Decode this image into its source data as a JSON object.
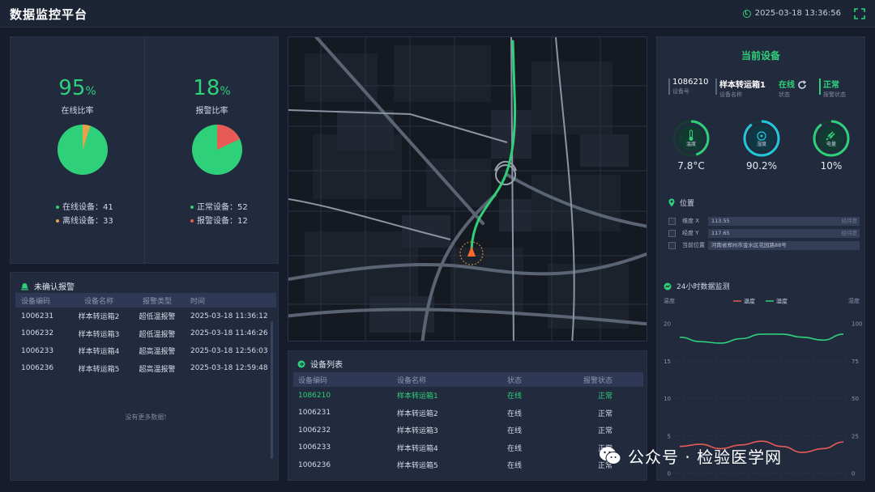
{
  "app": {
    "title": "数据监控平台",
    "datetime": "2025-03-18 13:36:56"
  },
  "online_ratio": {
    "value": "95",
    "unit": "%",
    "label": "在线比率",
    "fraction": 0.95,
    "colors": {
      "main": "#2fd07a",
      "other": "#e8a04a"
    },
    "legend": [
      {
        "label": "在线设备：41",
        "color": "#2fd07a"
      },
      {
        "label": "离线设备：33",
        "color": "#e8a04a"
      }
    ]
  },
  "alarm_ratio": {
    "value": "18",
    "unit": "%",
    "label": "报警比率",
    "fraction": 0.82,
    "colors": {
      "main": "#2fd07a",
      "other": "#e85a55"
    },
    "legend": [
      {
        "label": "正常设备：52",
        "color": "#2fd07a"
      },
      {
        "label": "报警设备：12",
        "color": "#e85a55"
      }
    ]
  },
  "unconfirmed_alarms": {
    "title": "未确认报警",
    "columns": [
      "设备编码",
      "设备名称",
      "报警类型",
      "时间"
    ],
    "rows": [
      [
        "1006231",
        "样本转运箱2",
        "超低温报警",
        "2025-03-18   11:36:12"
      ],
      [
        "1006232",
        "样本转运箱3",
        "超低温报警",
        "2025-03-18   11:46:26"
      ],
      [
        "1006233",
        "样本转运箱4",
        "超高温报警",
        "2025-03-18   12:56:03"
      ],
      [
        "1006236",
        "样本转运箱5",
        "超高温报警",
        "2025-03-18   12:59:48"
      ]
    ],
    "empty": "没有更多数据!"
  },
  "device_list": {
    "title": "设备列表",
    "columns": [
      "设备编码",
      "设备名称",
      "状态",
      "报警状态"
    ],
    "rows": [
      [
        "1086210",
        "样本转运箱1",
        "在线",
        "正常"
      ],
      [
        "1006231",
        "样本转运箱2",
        "在线",
        "正常"
      ],
      [
        "1006232",
        "样本转运箱3",
        "在线",
        "正常"
      ],
      [
        "1006233",
        "样本转运箱4",
        "在线",
        "正常"
      ],
      [
        "1006236",
        "样本转运箱5",
        "在线",
        "正常"
      ]
    ],
    "active_index": 0
  },
  "current_device": {
    "title": "当前设备",
    "id": "1086210",
    "id_label": "设备号",
    "name": "样本转运箱1",
    "name_label": "设备名称",
    "status": "在线",
    "status_label": "状态",
    "alarm": "正常",
    "alarm_label": "报警状态",
    "gauges": [
      {
        "label": "温度",
        "value": "7.8°C",
        "icon": "thermometer-icon",
        "color": "#2fd07a",
        "level": 0.45
      },
      {
        "label": "湿度",
        "value": "90.2%",
        "icon": "humidity-icon",
        "color": "#23c8d8",
        "level": 0.9
      },
      {
        "label": "电量",
        "value": "10%",
        "icon": "battery-plug-icon",
        "color": "#2fd07a",
        "level": 0.9
      }
    ],
    "location": {
      "title": "位置",
      "rows": [
        {
          "key": "维度 X",
          "value": "113.55",
          "hint": "经纬度"
        },
        {
          "key": "经度 Y",
          "value": "117.65",
          "hint": "经纬度"
        },
        {
          "key": "当前位置",
          "value": "河南省郑州市金水区花园路88号",
          "hint": ""
        }
      ]
    },
    "trend": {
      "title": "24小时数据监测",
      "left_axis_label": "温度",
      "right_axis_label": "湿度",
      "legend": [
        {
          "name": "温度",
          "color": "#e85a55"
        },
        {
          "name": "湿度",
          "color": "#2fd07a"
        }
      ],
      "left_ticks": [
        "20",
        "15",
        "10",
        "5",
        "0"
      ],
      "right_ticks": [
        "100",
        "75",
        "50",
        "25",
        "0"
      ]
    }
  },
  "chart_data": {
    "type": "line",
    "title": "24小时数据监测",
    "xlabel": "",
    "ylabel": "温度",
    "y2label": "湿度",
    "ylim": [
      0,
      20
    ],
    "y2lim": [
      0,
      100
    ],
    "x": [
      0,
      1,
      2,
      3,
      4,
      5,
      6,
      7,
      8
    ],
    "series": [
      {
        "name": "温度",
        "axis": "left",
        "color": "#e85a55",
        "values": [
          3.6,
          3.9,
          3.3,
          3.8,
          4.3,
          3.6,
          2.8,
          3.3,
          4.2
        ]
      },
      {
        "name": "湿度",
        "axis": "right",
        "color": "#2fd07a",
        "values": [
          91,
          88,
          87,
          90,
          93,
          93,
          91,
          89,
          93
        ]
      }
    ],
    "grid": true,
    "legend_position": "top"
  },
  "footer": {
    "text": "公众号 · 检验医学网"
  }
}
